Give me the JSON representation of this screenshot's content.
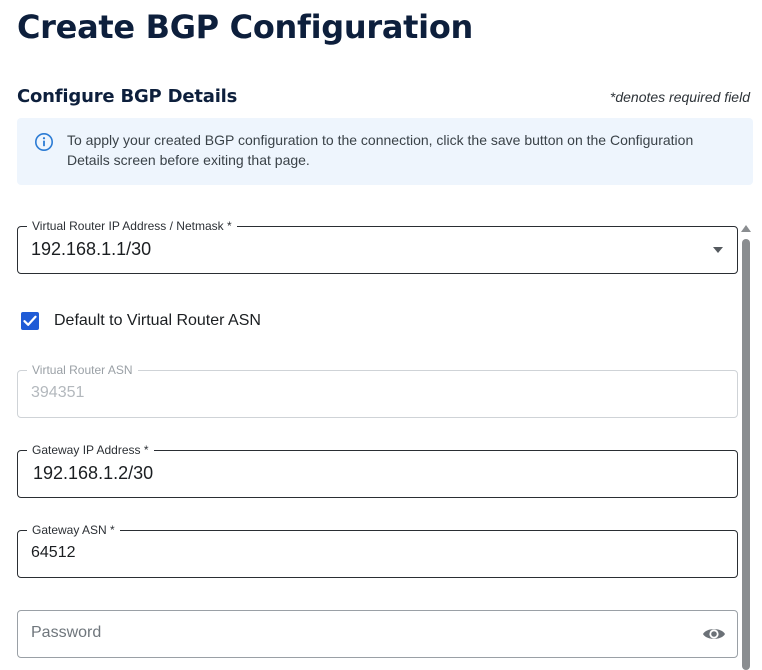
{
  "page": {
    "title": "Create BGP Configuration"
  },
  "section": {
    "title": "Configure BGP Details",
    "required_note": "*denotes required field"
  },
  "alert": {
    "icon": "info-circle-icon",
    "text": "To apply your created BGP configuration to the connection, click the save button on the Configuration Details screen before exiting that page."
  },
  "fields": {
    "virtual_router_ip": {
      "label": "Virtual Router IP Address / Netmask *",
      "value": "192.168.1.1/30"
    },
    "default_asn_checkbox": {
      "label": "Default to Virtual Router ASN",
      "checked": true
    },
    "virtual_router_asn": {
      "label": "Virtual Router ASN",
      "value": "394351",
      "disabled": true
    },
    "gateway_ip": {
      "label": "Gateway IP Address *",
      "value": "192.168.1.2/30"
    },
    "gateway_asn": {
      "label": "Gateway ASN *",
      "value": "64512"
    },
    "password": {
      "placeholder": "Password",
      "value": ""
    }
  },
  "colors": {
    "title": "#0d1f3c",
    "alert_background": "#eef5fd",
    "info_icon": "#2b7bd4",
    "checkbox": "#1f5bd6",
    "scrollbar": "#8a8d90"
  }
}
